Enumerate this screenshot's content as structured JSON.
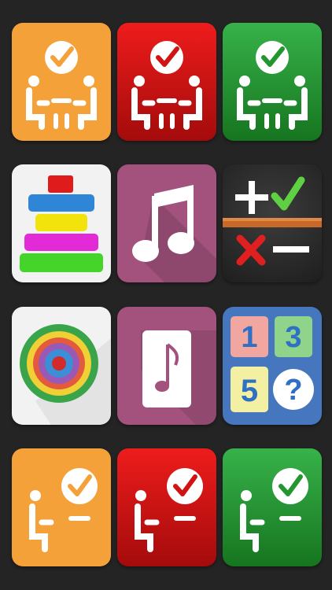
{
  "screen": {
    "background": "#242424"
  },
  "tiles": [
    {
      "icon": "two-people-meeting-check-icon",
      "color": "#f5a13a"
    },
    {
      "icon": "two-people-meeting-check-icon",
      "color": "#d11313"
    },
    {
      "icon": "two-people-meeting-check-icon",
      "color": "#23962f"
    },
    {
      "icon": "stacking-rings-toy-icon",
      "color": "#f2f2f2"
    },
    {
      "icon": "music-note-icon",
      "color": "#a3527d"
    },
    {
      "icon": "plus-check-cross-minus-icon",
      "color": "#2b2b2b"
    },
    {
      "icon": "concentric-target-icon",
      "color": "#f2f2f2"
    },
    {
      "icon": "music-card-icon",
      "color": "#a3527d"
    },
    {
      "icon": "number-cards-icon",
      "color": "#4676bd"
    },
    {
      "icon": "single-person-check-icon",
      "color": "#f5a13a"
    },
    {
      "icon": "single-person-check-icon",
      "color": "#d11313"
    },
    {
      "icon": "single-person-check-icon",
      "color": "#23962f"
    }
  ],
  "number_cards": {
    "top_left": "1",
    "top_right": "3",
    "bottom_left": "5",
    "bottom_right": "?"
  }
}
